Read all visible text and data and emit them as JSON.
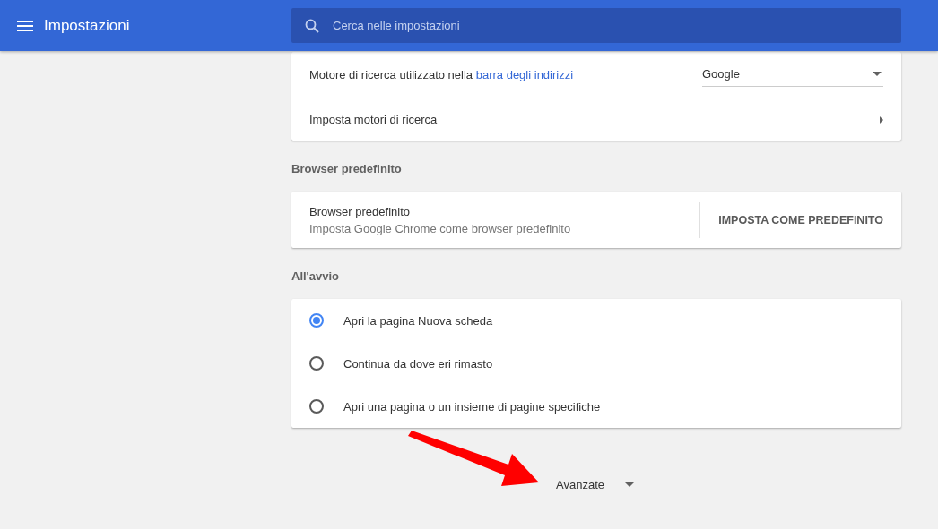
{
  "header": {
    "title": "Impostazioni",
    "search": {
      "placeholder": "Cerca nelle impostazioni"
    }
  },
  "search_engine_card": {
    "rows": [
      {
        "kind": "dropdown",
        "label": "Motore di ricerca utilizzato nella",
        "link": "barra degli indirizzi",
        "value": "Google"
      },
      {
        "kind": "submenu",
        "label": "Imposta motori di ricerca"
      }
    ]
  },
  "default_browser": {
    "heading": "Browser predefinito",
    "title": "Browser predefinito",
    "subtitle": "Imposta Google Chrome come browser predefinito",
    "button": "IMPOSTA COME PREDEFINITO"
  },
  "startup": {
    "heading": "All'avvio",
    "options": [
      {
        "label": "Apri la pagina Nuova scheda",
        "selected": true
      },
      {
        "label": "Continua da dove eri rimasto",
        "selected": false
      },
      {
        "label": "Apri una pagina o un insieme di pagine specifiche",
        "selected": false
      }
    ]
  },
  "advanced": {
    "label": "Avanzate",
    "expanded": false
  }
}
